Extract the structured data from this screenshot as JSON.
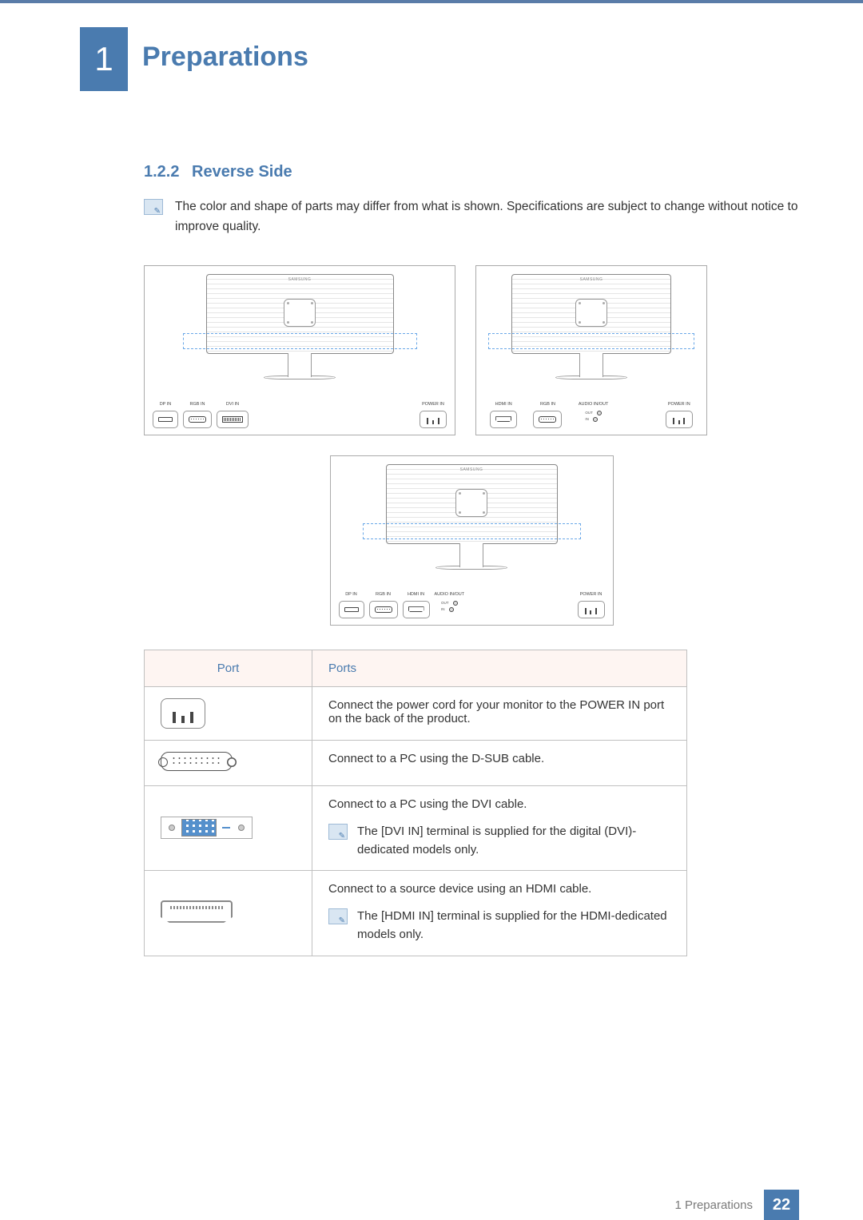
{
  "chapter": {
    "number": "1",
    "title": "Preparations"
  },
  "section": {
    "number": "1.2.2",
    "title": "Reverse Side"
  },
  "note_text": "The color and shape of parts may differ from what is shown. Specifications are subject to change without notice to improve quality.",
  "brand_label": "SAMSUNG",
  "port_labels": {
    "dp_in": "DP IN",
    "rgb_in": "RGB IN",
    "dvi_in": "DVI IN",
    "hdmi_in": "HDMI IN",
    "audio_inout": "AUDIO IN/OUT",
    "audio_out": "OUT",
    "audio_in": "IN",
    "power_in": "POWER IN"
  },
  "table": {
    "headers": {
      "port": "Port",
      "desc": "Ports"
    },
    "rows": [
      {
        "icon": "power",
        "desc": "Connect the power cord for your monitor to the POWER IN port on the back of the product."
      },
      {
        "icon": "vga",
        "desc": "Connect to a PC using the D-SUB cable."
      },
      {
        "icon": "dvi",
        "desc": "Connect to a PC using the DVI cable.",
        "note": "The [DVI IN] terminal is supplied for the digital (DVI)-dedicated models only."
      },
      {
        "icon": "hdmi",
        "desc": "Connect to a source device using an HDMI cable.",
        "note": "The [HDMI IN] terminal is supplied for the HDMI-dedicated models only."
      }
    ]
  },
  "footer": {
    "label": "1 Preparations",
    "page": "22"
  }
}
